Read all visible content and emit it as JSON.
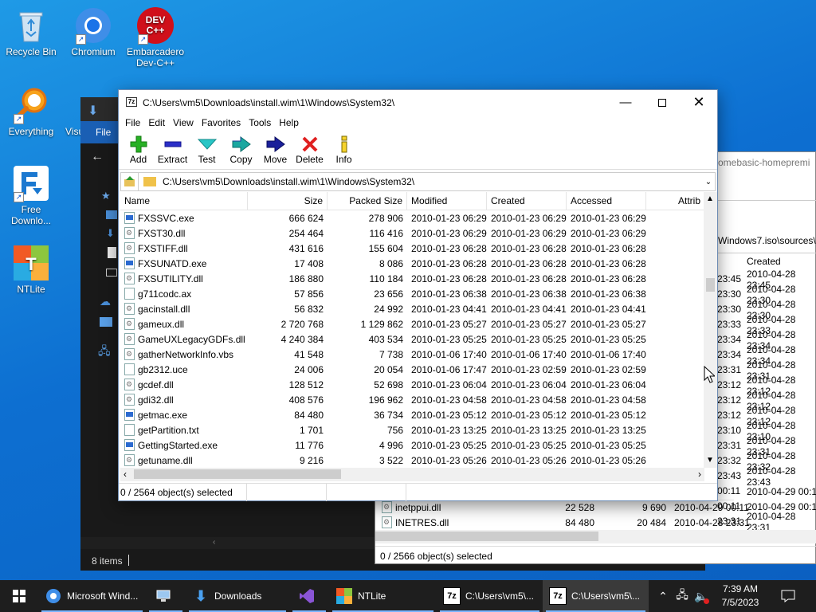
{
  "desktop": {
    "icons": [
      {
        "label": "Recycle Bin"
      },
      {
        "label": "Chromium"
      },
      {
        "label": "Embarcadero Dev-C++"
      },
      {
        "label": "Everything"
      },
      {
        "label": "Visu"
      },
      {
        "label": "Free Downlo..."
      },
      {
        "label": "NTLite"
      }
    ],
    "devcpp_logo": "DEV C++"
  },
  "explorer_bg": {
    "file_menu": "File",
    "status": "8 items"
  },
  "win2": {
    "path_fragment": "omebasic-homepremi",
    "path2_fragment": "Windows7.iso\\sources\\i",
    "col_created": "Created",
    "left_times": [
      "23:45",
      "23:30",
      "23:30",
      "23:33",
      "23:34",
      "23:34",
      "23:31",
      "23:12",
      "23:12",
      "23:12",
      "23:10",
      "23:31",
      "23:32",
      "23:43",
      "00:11",
      "00:11",
      "23:31"
    ],
    "right_dates": [
      "2010-04-28 23:45",
      "2010-04-28 23:30",
      "2010-04-28 23:30",
      "2010-04-28 23:33",
      "2010-04-28 23:34",
      "2010-04-28 23:34",
      "2010-04-28 23:31",
      "2010-04-28 23:12",
      "2010-04-28 23:12",
      "2010-04-28 23:12",
      "2010-04-28 23:10",
      "2010-04-28 23:31",
      "2010-04-28 23:32",
      "2010-04-28 23:43",
      "2010-04-29 00:11",
      "2010-04-29 00:11",
      "2010-04-28 23:31"
    ],
    "rows": [
      {
        "name": "inetppui.dll",
        "size": "22 528",
        "packed": "9 690",
        "modified": "2010-04-29 00:11"
      },
      {
        "name": "INETRES.dll",
        "size": "84 480",
        "packed": "20 484",
        "modified": "2010-04-28 23:31"
      }
    ],
    "status": "0 / 2566 object(s) selected"
  },
  "main": {
    "title": "C:\\Users\\vm5\\Downloads\\install.wim\\1\\Windows\\System32\\",
    "menu": [
      "File",
      "Edit",
      "View",
      "Favorites",
      "Tools",
      "Help"
    ],
    "toolbar": {
      "add": "Add",
      "extract": "Extract",
      "test": "Test",
      "copy": "Copy",
      "move": "Move",
      "delete": "Delete",
      "info": "Info"
    },
    "address": "C:\\Users\\vm5\\Downloads\\install.wim\\1\\Windows\\System32\\",
    "columns": {
      "name": "Name",
      "size": "Size",
      "packed": "Packed Size",
      "modified": "Modified",
      "created": "Created",
      "accessed": "Accessed",
      "attrib": "Attrib"
    },
    "rows": [
      {
        "name": "FXSSVC.exe",
        "type": "exe",
        "size": "666 624",
        "packed": "278 906",
        "modified": "2010-01-23 06:29",
        "created": "2010-01-23 06:29",
        "accessed": "2010-01-23 06:29"
      },
      {
        "name": "FXST30.dll",
        "type": "dll",
        "size": "254 464",
        "packed": "116 416",
        "modified": "2010-01-23 06:29",
        "created": "2010-01-23 06:29",
        "accessed": "2010-01-23 06:29"
      },
      {
        "name": "FXSTIFF.dll",
        "type": "dll",
        "size": "431 616",
        "packed": "155 604",
        "modified": "2010-01-23 06:28",
        "created": "2010-01-23 06:28",
        "accessed": "2010-01-23 06:28"
      },
      {
        "name": "FXSUNATD.exe",
        "type": "exe",
        "size": "17 408",
        "packed": "8 086",
        "modified": "2010-01-23 06:28",
        "created": "2010-01-23 06:28",
        "accessed": "2010-01-23 06:28"
      },
      {
        "name": "FXSUTILITY.dll",
        "type": "dll",
        "size": "186 880",
        "packed": "110 184",
        "modified": "2010-01-23 06:28",
        "created": "2010-01-23 06:28",
        "accessed": "2010-01-23 06:28"
      },
      {
        "name": "g711codc.ax",
        "type": "file",
        "size": "57 856",
        "packed": "23 656",
        "modified": "2010-01-23 06:38",
        "created": "2010-01-23 06:38",
        "accessed": "2010-01-23 06:38"
      },
      {
        "name": "gacinstall.dll",
        "type": "dll",
        "size": "56 832",
        "packed": "24 992",
        "modified": "2010-01-23 04:41",
        "created": "2010-01-23 04:41",
        "accessed": "2010-01-23 04:41"
      },
      {
        "name": "gameux.dll",
        "type": "dll",
        "size": "2 720 768",
        "packed": "1 129 862",
        "modified": "2010-01-23 05:27",
        "created": "2010-01-23 05:27",
        "accessed": "2010-01-23 05:27"
      },
      {
        "name": "GameUXLegacyGDFs.dll",
        "type": "dll",
        "size": "4 240 384",
        "packed": "403 534",
        "modified": "2010-01-23 05:25",
        "created": "2010-01-23 05:25",
        "accessed": "2010-01-23 05:25"
      },
      {
        "name": "gatherNetworkInfo.vbs",
        "type": "vbs",
        "size": "41 548",
        "packed": "7 738",
        "modified": "2010-01-06 17:40",
        "created": "2010-01-06 17:40",
        "accessed": "2010-01-06 17:40"
      },
      {
        "name": "gb2312.uce",
        "type": "file",
        "size": "24 006",
        "packed": "20 054",
        "modified": "2010-01-06 17:47",
        "created": "2010-01-23 02:59",
        "accessed": "2010-01-23 02:59"
      },
      {
        "name": "gcdef.dll",
        "type": "dll",
        "size": "128 512",
        "packed": "52 698",
        "modified": "2010-01-23 06:04",
        "created": "2010-01-23 06:04",
        "accessed": "2010-01-23 06:04"
      },
      {
        "name": "gdi32.dll",
        "type": "dll",
        "size": "408 576",
        "packed": "196 962",
        "modified": "2010-01-23 04:58",
        "created": "2010-01-23 04:58",
        "accessed": "2010-01-23 04:58"
      },
      {
        "name": "getmac.exe",
        "type": "exe",
        "size": "84 480",
        "packed": "36 734",
        "modified": "2010-01-23 05:12",
        "created": "2010-01-23 05:12",
        "accessed": "2010-01-23 05:12"
      },
      {
        "name": "getPartition.txt",
        "type": "file",
        "size": "1 701",
        "packed": "756",
        "modified": "2010-01-23 13:25",
        "created": "2010-01-23 13:25",
        "accessed": "2010-01-23 13:25"
      },
      {
        "name": "GettingStarted.exe",
        "type": "exe",
        "size": "11 776",
        "packed": "4 996",
        "modified": "2010-01-23 05:25",
        "created": "2010-01-23 05:25",
        "accessed": "2010-01-23 05:25"
      },
      {
        "name": "getuname.dll",
        "type": "dll",
        "size": "9 216",
        "packed": "3 522",
        "modified": "2010-01-23 05:26",
        "created": "2010-01-23 05:26",
        "accessed": "2010-01-23 05:26"
      }
    ],
    "status": "0 / 2564 object(s) selected"
  },
  "taskbar": {
    "items": [
      {
        "label": "Microsoft Wind...",
        "icon": "chromium-icon"
      },
      {
        "label": "",
        "icon": "network-computer-icon"
      },
      {
        "label": "Downloads",
        "icon": "downloads-folder-icon"
      },
      {
        "label": "",
        "icon": "visual-studio-icon"
      },
      {
        "label": "NTLite",
        "icon": "ntlite-icon"
      },
      {
        "label": "C:\\Users\\vm5\\...",
        "icon": "7zip-icon"
      },
      {
        "label": "C:\\Users\\vm5\\...",
        "icon": "7zip-icon"
      }
    ],
    "time": "7:39 AM",
    "date": "7/5/2023",
    "zip_glyph": "7z"
  }
}
